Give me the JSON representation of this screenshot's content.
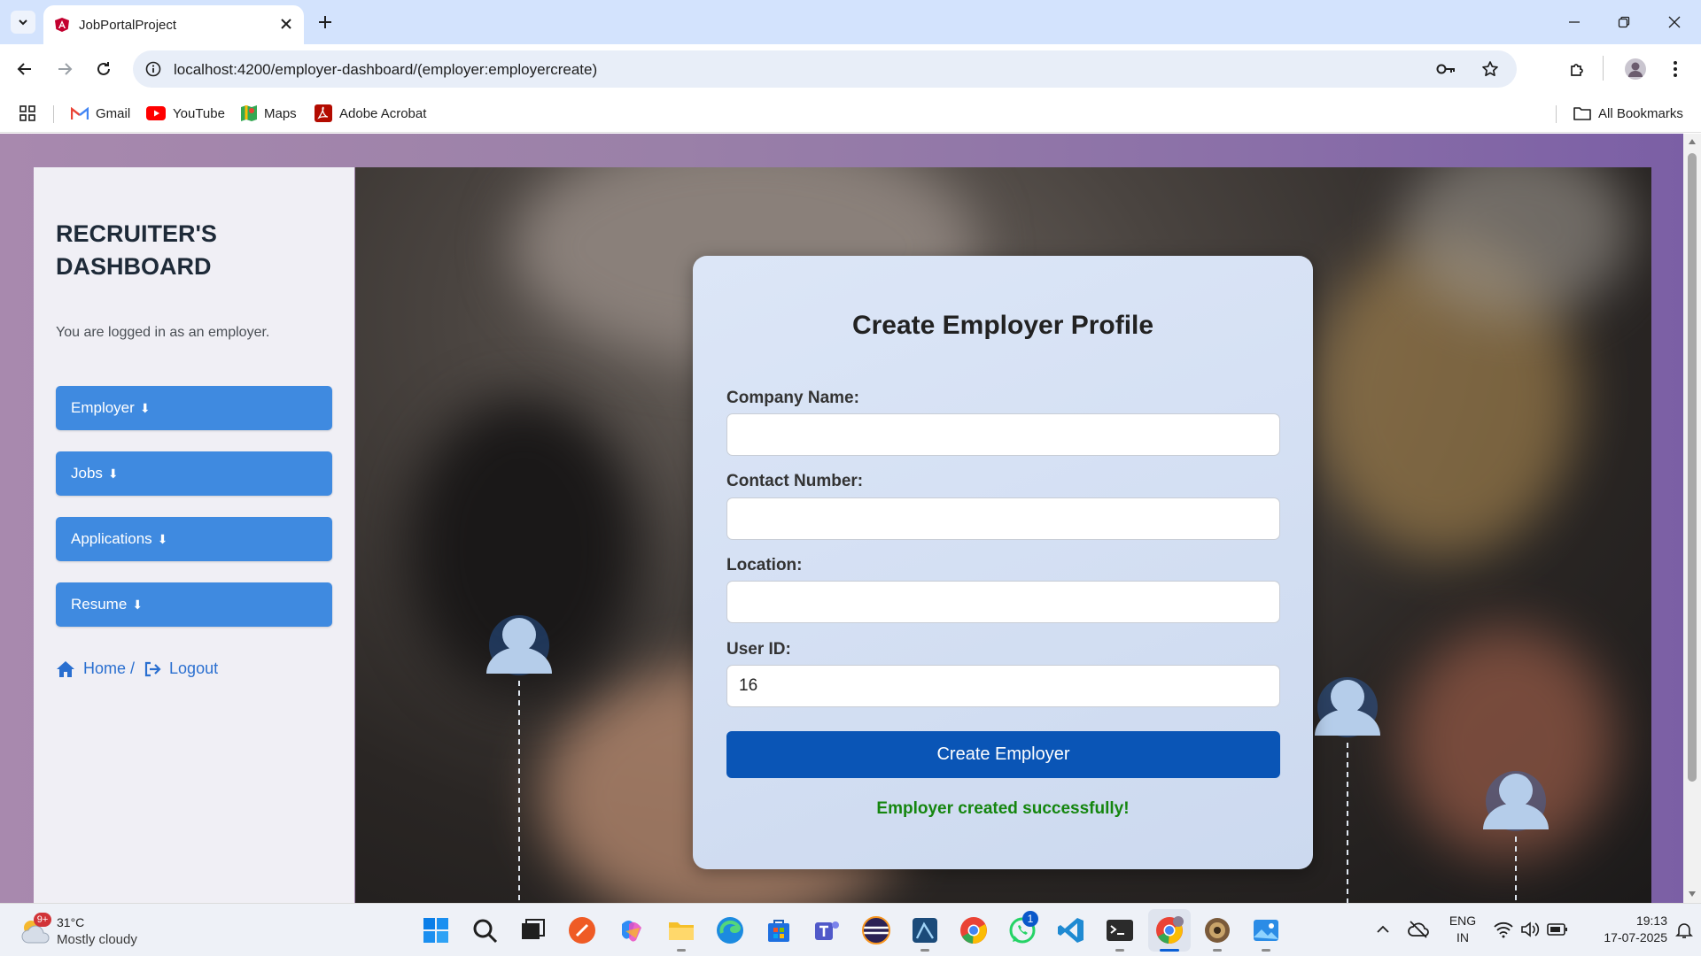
{
  "browser": {
    "tab_title": "JobPortalProject",
    "url": "localhost:4200/employer-dashboard/(employer:employercreate)",
    "bookmarks": [
      "Gmail",
      "YouTube",
      "Maps",
      "Adobe Acrobat"
    ],
    "all_bookmarks": "All Bookmarks"
  },
  "sidebar": {
    "brand": "RECRUITER'S DASHBOARD",
    "login_note": "You are logged in as an employer.",
    "menu": [
      {
        "label": "Employer",
        "arrow": "⬇"
      },
      {
        "label": "Jobs",
        "arrow": "⬇"
      },
      {
        "label": "Applications",
        "arrow": "⬇"
      },
      {
        "label": "Resume",
        "arrow": "⬇"
      }
    ],
    "home_label": "Home /",
    "logout_label": "Logout"
  },
  "form": {
    "title": "Create Employer Profile",
    "fields": [
      {
        "label": "Company Name:",
        "value": ""
      },
      {
        "label": "Contact Number:",
        "value": ""
      },
      {
        "label": "Location:",
        "value": ""
      },
      {
        "label": "User ID:",
        "value": "16"
      }
    ],
    "submit_label": "Create Employer",
    "success_message": "Employer created successfully!"
  },
  "taskbar": {
    "weather_temp": "31°C",
    "weather_desc": "Mostly cloudy",
    "weather_badge": "9+",
    "whatsapp_badge": "1",
    "lang_line1": "ENG",
    "lang_line2": "IN",
    "time": "19:13",
    "date": "17-07-2025"
  },
  "colors": {
    "accent_button": "#0a55b6",
    "sidebar_button": "#3f8ae0",
    "success": "#15860f"
  }
}
